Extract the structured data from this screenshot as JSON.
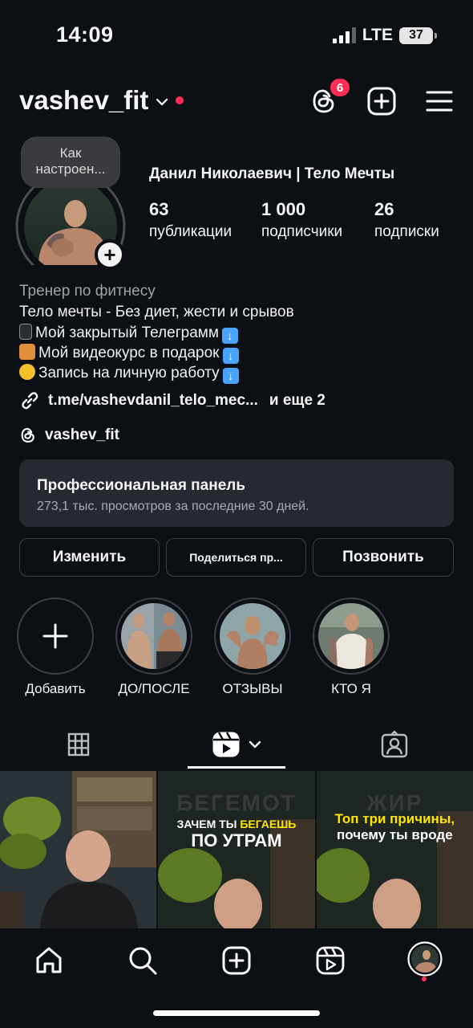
{
  "status_bar": {
    "time": "14:09",
    "network": "LTE",
    "battery": "37"
  },
  "header": {
    "username": "vashev_fit",
    "threads_badge": "6"
  },
  "profile": {
    "note": "Как настроен...",
    "display_name": "Данил Николаевич | Тело Мечты",
    "stats": [
      {
        "value": "63",
        "label": "публикации"
      },
      {
        "value": "1 000",
        "label": "подписчики"
      },
      {
        "value": "26",
        "label": "подписки"
      }
    ],
    "bio_category": "Тренер по фитнесу",
    "bio_lines": [
      "Тело мечты - Без диет, жести и срывов",
      "Мой закрытый Телеграмм",
      "Мой видеокурс в подарок",
      "Запись на личную работу"
    ],
    "link": "t.me/vashevdanil_telo_mec...",
    "link_more": "и еще 2",
    "threads_handle": "vashev_fit"
  },
  "pro_panel": {
    "title": "Профессиональная панель",
    "subtitle": "273,1 тыс. просмотров за последние 30 дней."
  },
  "buttons": {
    "edit": "Изменить",
    "share": "Поделиться пр...",
    "call": "Позвонить"
  },
  "highlights": [
    {
      "label": "Добавить"
    },
    {
      "label": "ДО/ПОСЛЕ"
    },
    {
      "label": "ОТЗЫВЫ"
    },
    {
      "label": "КТО Я"
    }
  ],
  "grid_posts": [
    {
      "bg_word": "",
      "line1": "",
      "line2": ""
    },
    {
      "bg_word": "БЕГЕМОТ",
      "line1_a": "ЗАЧЕМ ТЫ ",
      "line1_b": "БЕГАЕШЬ",
      "line2": "ПО УТРАМ"
    },
    {
      "bg_word": "ЖИР",
      "line1": "Топ три причины,",
      "line2": "почему ты вроде"
    }
  ],
  "colors": {
    "background": "#0c0f14",
    "accent_red": "#ff2d55",
    "panel": "#262930",
    "highlight_yellow": "#ffe500"
  }
}
